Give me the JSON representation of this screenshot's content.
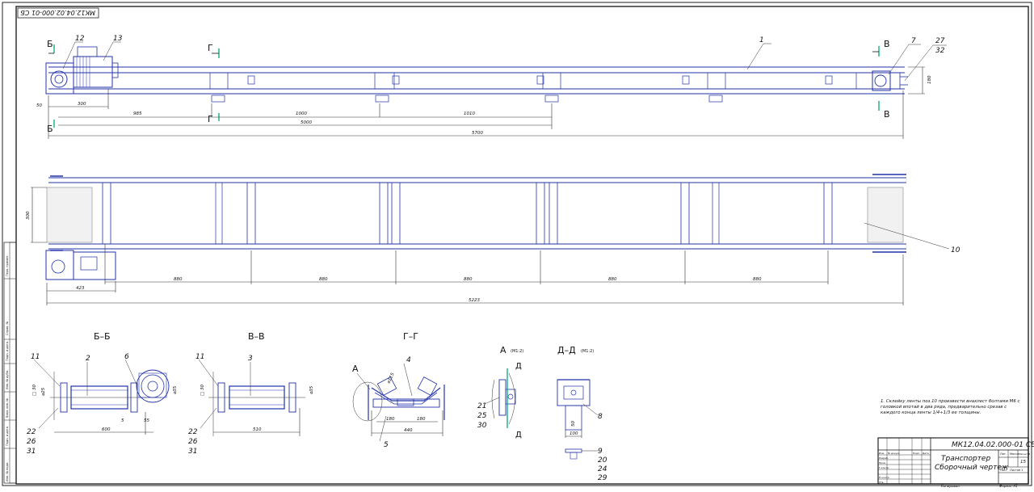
{
  "drawing": {
    "doc_code": "МК12.04.02.000-01 СБ",
    "doc_code_rotated": "МК12.04.02.000-01 СБ",
    "title_line1": "Транспортер",
    "title_line2": "Сборочный чертеж",
    "scale": "1:5",
    "sheet": "15",
    "copied_label": "Копировал",
    "format_label": "Формат  А1"
  },
  "sections": {
    "bb": "Б–Б",
    "vv": "В–В",
    "gg": "Г–Г",
    "a_view": "А",
    "a_scale": "(М1:2)",
    "dd": "Д–Д",
    "dd_scale": "(М1:2)"
  },
  "section_marks": {
    "b": "Б",
    "v": "В",
    "g": "Г",
    "a": "А",
    "d": "Д"
  },
  "note": "1. Склейку ленты поз.10 произвести внахлест болтами М6 с головкой впотай в два ряда, предварительно срезав с каждого конца ленты 1/4÷1/3 ее толщины.",
  "front_view": {
    "dims": {
      "d50": "50",
      "d300": "300",
      "d985": "985",
      "d1000": "1000",
      "d1010": "1010",
      "d5000": "5000",
      "d5700": "5700",
      "d180": "180"
    },
    "callouts": {
      "p1": "1",
      "p7": "7",
      "p12": "12",
      "p13": "13",
      "p27": "27",
      "p32": "32"
    }
  },
  "plan_view": {
    "dims": {
      "d300": "300",
      "d423": "423",
      "d880_1": "880",
      "d880_2": "880",
      "d880_3": "880",
      "d880_4": "880",
      "d880_5": "880",
      "d5223": "5223"
    },
    "callouts": {
      "p10": "10"
    }
  },
  "section_bb": {
    "dims": {
      "d600": "600",
      "d5": "5",
      "d55": "55",
      "dsq": "□ 30",
      "dphi": "⌀25",
      "dphi2": "⌀35"
    },
    "callouts": {
      "p11": "11",
      "p2": "2",
      "p6": "6",
      "p22": "22",
      "p26": "26",
      "p31": "31"
    }
  },
  "section_vv": {
    "dims": {
      "d510": "510",
      "dsq": "□ 30",
      "dphi": "⌀35"
    },
    "callouts": {
      "p11": "11",
      "p3": "3",
      "p22": "22",
      "p26": "26",
      "p31": "31"
    }
  },
  "section_gg": {
    "dims": {
      "d180a": "180",
      "d180b": "180",
      "d440": "440",
      "dphi": "⌀115"
    },
    "callouts": {
      "p4": "4",
      "p5": "5"
    }
  },
  "view_a": {
    "callouts": {
      "p21": "21",
      "p25": "25",
      "p30": "30"
    }
  },
  "section_dd": {
    "dims": {
      "d50": "50",
      "d100": "100"
    },
    "callouts": {
      "p8": "8",
      "p9": "9",
      "p20": "20",
      "p24": "24",
      "p29": "29"
    }
  },
  "title_block": {
    "rows": [
      "Изм.",
      "Лист",
      "№ докум.",
      "Подп.",
      "Дата"
    ],
    "roles": [
      "Разраб.",
      "Пров.",
      "Т.контр.",
      "Н.контр.",
      "Утв."
    ],
    "lit": "Лит.",
    "mass": "Масса",
    "scale_h": "Масштаб",
    "list": "Лист",
    "lists": "Листов 1"
  },
  "side_stamps": [
    "Перв. примен.",
    "Справ. №",
    "Подп. и дата",
    "Инв. № дубл.",
    "Взам. инв. №",
    "Подп. и дата",
    "Инв. № подл."
  ]
}
